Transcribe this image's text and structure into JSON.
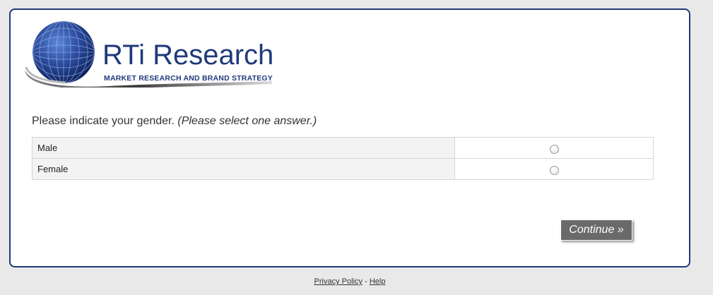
{
  "logo": {
    "name": "RTi Research",
    "tagline": "MARKET RESEARCH AND BRAND STRATEGY",
    "color": "#1f3a7a"
  },
  "question": {
    "text": "Please indicate your gender.",
    "instruction": "(Please select one answer.)"
  },
  "answers": [
    {
      "label": "Male",
      "selected": false
    },
    {
      "label": "Female",
      "selected": false
    }
  ],
  "continue_label": "Continue »",
  "footer": {
    "privacy_label": "Privacy Policy",
    "separator": "-",
    "help_label": "Help"
  },
  "colors": {
    "frame_border": "#1f3a7a",
    "button_bg": "#6a6a6a",
    "page_bg": "#e9e9e9"
  }
}
